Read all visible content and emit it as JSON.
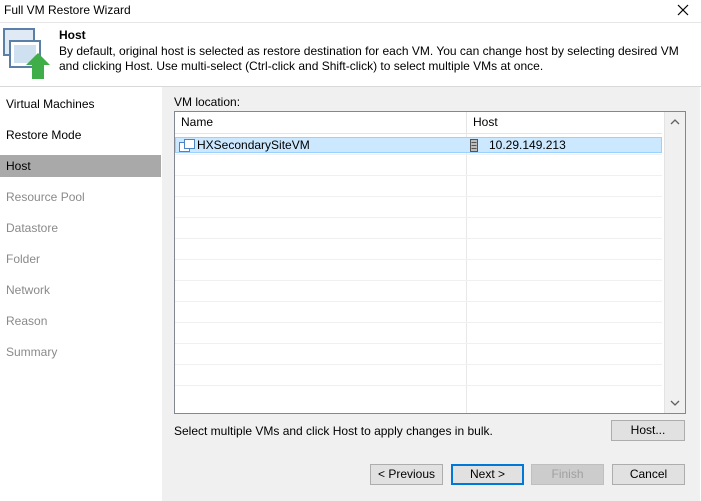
{
  "window": {
    "title": "Full VM Restore Wizard"
  },
  "header": {
    "title": "Host",
    "description": "By default, original host is selected as restore destination for each VM. You can change host by selecting desired VM and clicking Host. Use multi-select (Ctrl-click and Shift-click) to select multiple VMs at once."
  },
  "sidebar": {
    "steps": [
      {
        "label": "Virtual Machines",
        "state": "done"
      },
      {
        "label": "Restore Mode",
        "state": "done"
      },
      {
        "label": "Host",
        "state": "active"
      },
      {
        "label": "Resource Pool",
        "state": "pending"
      },
      {
        "label": "Datastore",
        "state": "pending"
      },
      {
        "label": "Folder",
        "state": "pending"
      },
      {
        "label": "Network",
        "state": "pending"
      },
      {
        "label": "Reason",
        "state": "pending"
      },
      {
        "label": "Summary",
        "state": "pending"
      }
    ]
  },
  "main": {
    "vm_location_label": "VM location:",
    "table": {
      "columns": [
        "Name",
        "Host"
      ],
      "rows": [
        {
          "name": "HXSecondarySiteVM",
          "host": "10.29.149.213",
          "selected": true
        }
      ]
    },
    "hint": "Select multiple VMs and click Host to apply changes in bulk.",
    "host_button": "Host..."
  },
  "footer": {
    "previous": "< Previous",
    "next": "Next >",
    "finish": "Finish",
    "cancel": "Cancel"
  },
  "icons": {
    "close": "close-icon",
    "wizard": "host-restore-icon",
    "vm": "vm-icon",
    "host": "host-server-icon"
  },
  "colors": {
    "active_step": "#a9a9a9",
    "selection": "#cce8ff",
    "primary_border": "#0078d7",
    "arrow_green": "#3fae49"
  }
}
